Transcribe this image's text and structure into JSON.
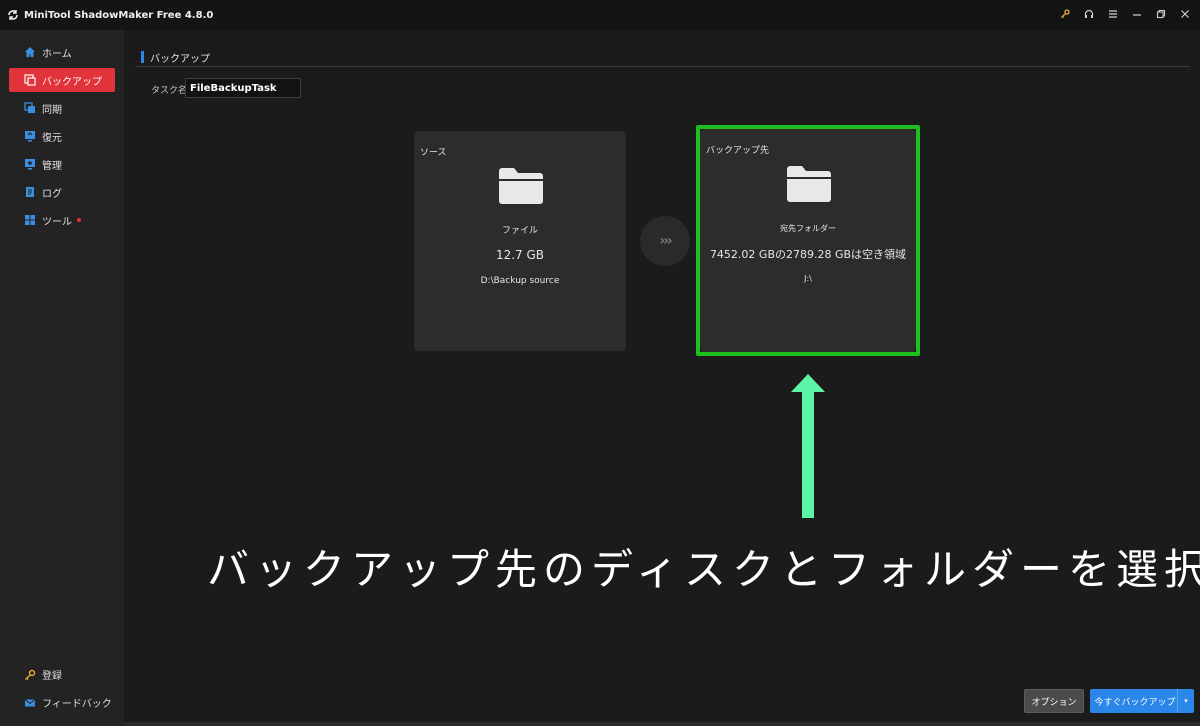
{
  "window": {
    "title": "MiniTool ShadowMaker Free 4.8.0",
    "controls": [
      "key-icon",
      "headset-icon",
      "menu-icon",
      "minimize-icon",
      "restore-icon",
      "close-icon"
    ]
  },
  "sidebar": {
    "items": [
      {
        "label": "ホーム",
        "icon": "home-icon"
      },
      {
        "label": "バックアップ",
        "icon": "backup-icon",
        "active": true
      },
      {
        "label": "同期",
        "icon": "sync-icon"
      },
      {
        "label": "復元",
        "icon": "restore-icon"
      },
      {
        "label": "管理",
        "icon": "manage-icon"
      },
      {
        "label": "ログ",
        "icon": "log-icon"
      },
      {
        "label": "ツール",
        "icon": "tools-icon",
        "badge": "red-dot"
      }
    ],
    "bottom": [
      {
        "label": "登録",
        "icon": "key-icon"
      },
      {
        "label": "フィードバック",
        "icon": "mail-icon"
      }
    ]
  },
  "page": {
    "section_title": "バックアップ",
    "task_label": "タスク名:",
    "task_name": "FileBackupTask"
  },
  "source_card": {
    "label": "ソース",
    "type": "ファイル",
    "size": "12.7 GB",
    "path": "D:\\Backup source"
  },
  "dest_card": {
    "label": "バックアップ先",
    "type": "宛先フォルダー",
    "free_space": "7452.02 GBの2789.28 GBは空き領域",
    "path": "J:\\"
  },
  "arrow_glyph": "›››",
  "annotation": {
    "text": "バックアップ先のディスクとフォルダーを選択",
    "color": "#1fbf1f",
    "arrow_color": "#5cf5a8"
  },
  "buttons": {
    "options": "オプション",
    "backup_now": "今すぐバックアップ",
    "caret": "▾"
  },
  "colors": {
    "accent_red": "#e0333a",
    "accent_blue": "#2a86e8"
  }
}
